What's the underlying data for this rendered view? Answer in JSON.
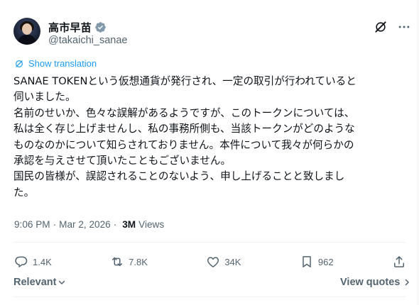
{
  "author": {
    "display_name": "高市早苗",
    "handle": "@takaichi_sanae"
  },
  "icons": {
    "avatar": "avatar-photo",
    "verified": "verified-badge-icon",
    "grok": "grok-icon",
    "more": "more-icon"
  },
  "translate": {
    "label": "Show translation"
  },
  "tweet": {
    "lines": [
      "SANAE TOKENという仮想通貨が発行され、一定の取引が行われていると",
      "伺いました。",
      "名前のせいか、色々な誤解があるようですが、このトークンについては、",
      "私は全く存じ上げませんし、私の事務所側も、当該トークンがどのような",
      "ものなのかについて知らされておりません。本件について我々が何らかの",
      "承認を与えさせて頂いたこともございません。",
      "国民の皆様が、誤認されることのないよう、申し上げることと致しまし",
      "た。"
    ]
  },
  "meta": {
    "time": "9:06 PM",
    "separator": "·",
    "date": "Mar 2, 2026",
    "views_count": "3M",
    "views_label": "Views"
  },
  "actions": {
    "replies": "1.4K",
    "reposts": "7.8K",
    "likes": "34K",
    "bookmarks": "962"
  },
  "footer": {
    "sort_label": "Relevant",
    "view_quotes_label": "View quotes"
  },
  "colors": {
    "accent": "#1d9bf0",
    "text": "#0f1419",
    "secondary": "#536471",
    "divider": "#eff3f4"
  }
}
